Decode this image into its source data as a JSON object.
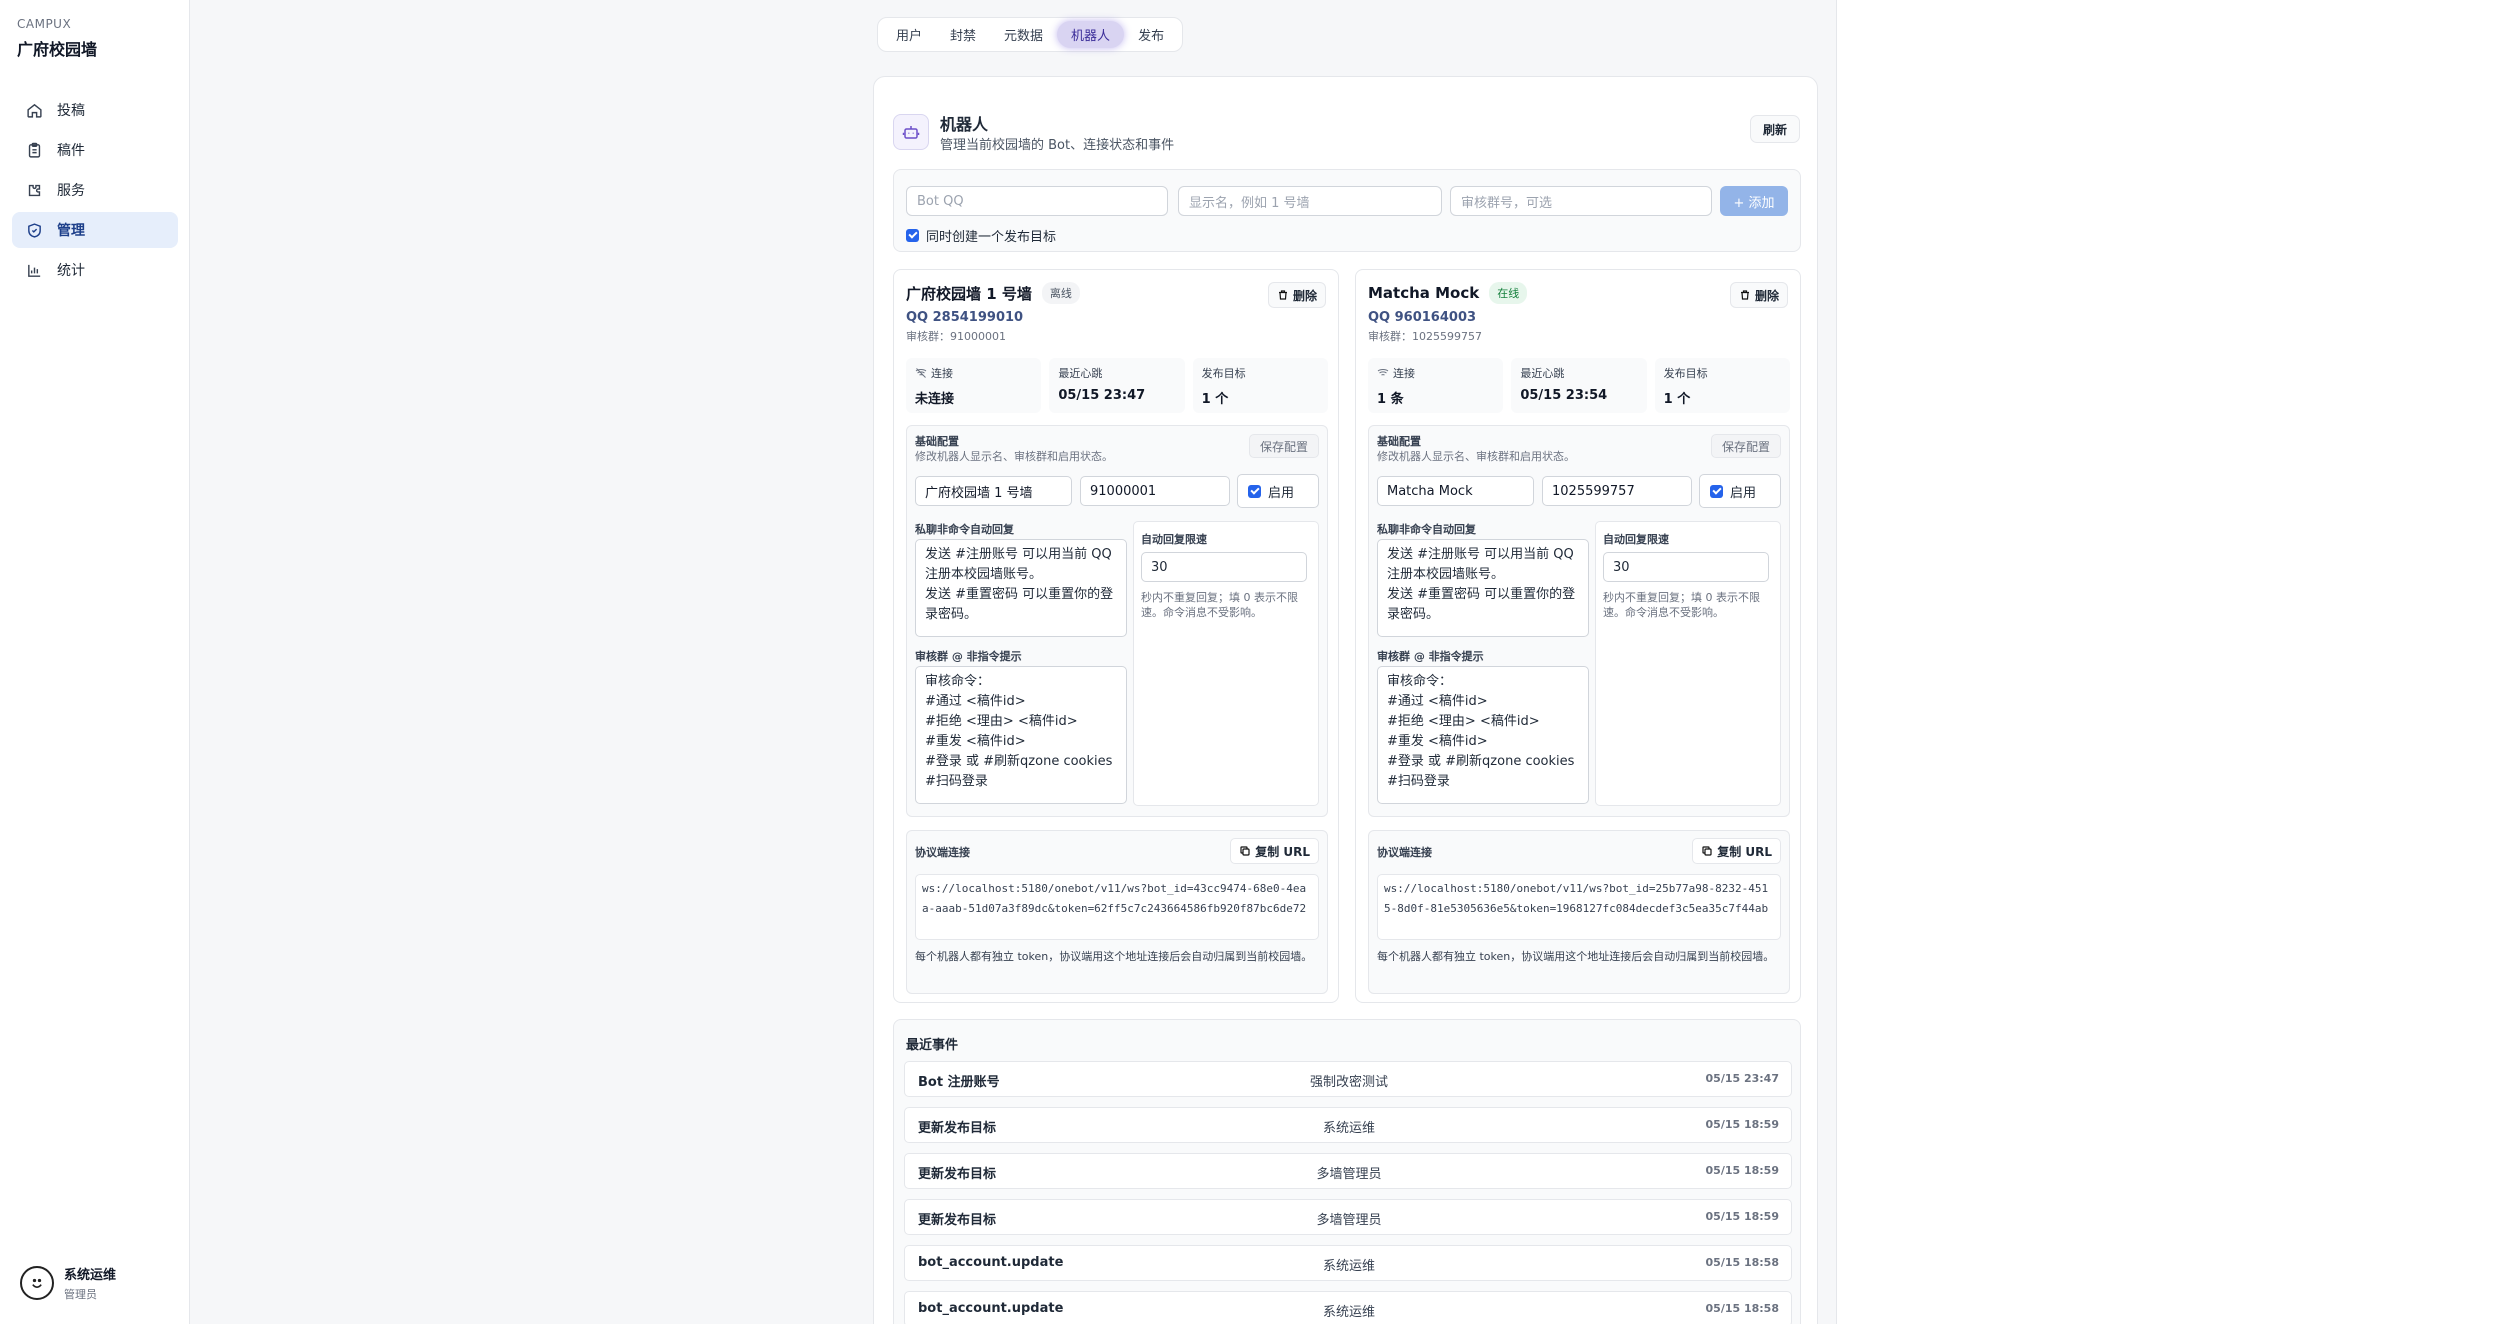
{
  "brand": {
    "small": "CAMPUX",
    "title": "广府校园墙"
  },
  "nav": [
    {
      "label": "投稿",
      "icon": "home-icon",
      "active": false
    },
    {
      "label": "稿件",
      "icon": "clipboard-icon",
      "active": false
    },
    {
      "label": "服务",
      "icon": "puzzle-icon",
      "active": false
    },
    {
      "label": "管理",
      "icon": "shield-check-icon",
      "active": true
    },
    {
      "label": "统计",
      "icon": "bar-chart-icon",
      "active": false
    }
  ],
  "user": {
    "name": "系统运维",
    "role": "管理员"
  },
  "tabs": [
    {
      "label": "用户"
    },
    {
      "label": "封禁"
    },
    {
      "label": "元数据"
    },
    {
      "label": "机器人",
      "active": true
    },
    {
      "label": "发布"
    }
  ],
  "header": {
    "title": "机器人",
    "subtitle": "管理当前校园墙的 Bot、连接状态和事件",
    "refresh_label": "刷新"
  },
  "add_form": {
    "qq_placeholder": "Bot QQ",
    "name_placeholder": "显示名，例如 1 号墙",
    "group_placeholder": "审核群号，可选",
    "add_label": "+ 添加",
    "checkbox_label": "同时创建一个发布目标",
    "checkbox_checked": true
  },
  "bots": [
    {
      "name": "广府校园墙 1 号墙",
      "status": "离线",
      "delete_label": "删除",
      "qq": "QQ 2854199010",
      "review_group": "审核群：91000001",
      "stats": [
        {
          "label": "连接",
          "value": "未连接"
        },
        {
          "label": "最近心跳",
          "value": "05/15 23:47"
        },
        {
          "label": "发布目标",
          "value": "1 个"
        }
      ],
      "config": {
        "title": "基础配置",
        "subtitle": "修改机器人显示名、审核群和启用状态。",
        "save_label": "保存配置",
        "name_value": "广府校园墙 1 号墙",
        "group_value": "91000001",
        "enable_label": "启用",
        "private_label": "私聊非命令自动回复",
        "private_text": "发送 #注册账号 可以用当前 QQ 注册本校园墙账号。\n发送 #重置密码 可以重置你的登录密码。",
        "group_label": "审核群 @ 非指令提示",
        "group_text": "审核命令：\n#通过 <稿件id>\n#拒绝 <理由> <稿件id>\n#重发 <稿件id>\n#登录 或 #刷新qzone cookies\n#扫码登录",
        "rate_label": "自动回复限速",
        "rate_value": "30",
        "rate_hint": "秒内不重复回复；填 0 表示不限速。命令消息不受影响。"
      },
      "protocol": {
        "label": "协议端连接",
        "copy_label": "复制 URL",
        "url": "ws://localhost:5180/onebot/v11/ws?bot_id=43cc9474-68e0-4eaa-aaab-51d07a3f89dc&token=62ff5c7c243664586fb920f87bc6de72",
        "hint": "每个机器人都有独立 token，协议端用这个地址连接后会自动归属到当前校园墙。"
      }
    },
    {
      "name": "Matcha Mock",
      "status": "在线",
      "delete_label": "删除",
      "qq": "QQ 960164003",
      "review_group": "审核群：1025599757",
      "stats": [
        {
          "label": "连接",
          "value": "1 条"
        },
        {
          "label": "最近心跳",
          "value": "05/15 23:54"
        },
        {
          "label": "发布目标",
          "value": "1 个"
        }
      ],
      "config": {
        "title": "基础配置",
        "subtitle": "修改机器人显示名、审核群和启用状态。",
        "save_label": "保存配置",
        "name_value": "Matcha Mock",
        "group_value": "1025599757",
        "enable_label": "启用",
        "private_label": "私聊非命令自动回复",
        "private_text": "发送 #注册账号 可以用当前 QQ 注册本校园墙账号。\n发送 #重置密码 可以重置你的登录密码。",
        "group_label": "审核群 @ 非指令提示",
        "group_text": "审核命令：\n#通过 <稿件id>\n#拒绝 <理由> <稿件id>\n#重发 <稿件id>\n#登录 或 #刷新qzone cookies\n#扫码登录",
        "rate_label": "自动回复限速",
        "rate_value": "30",
        "rate_hint": "秒内不重复回复；填 0 表示不限速。命令消息不受影响。"
      },
      "protocol": {
        "label": "协议端连接",
        "copy_label": "复制 URL",
        "url": "ws://localhost:5180/onebot/v11/ws?bot_id=25b77a98-8232-4515-8d0f-81e5305636e5&token=1968127fc084decdef3c5ea35c7f44ab",
        "hint": "每个机器人都有独立 token，协议端用这个地址连接后会自动归属到当前校园墙。"
      }
    }
  ],
  "events": {
    "title": "最近事件",
    "rows": [
      {
        "name": "Bot 注册账号",
        "actor": "强制改密测试",
        "time": "05/15 23:47"
      },
      {
        "name": "更新发布目标",
        "actor": "系统运维",
        "time": "05/15 18:59"
      },
      {
        "name": "更新发布目标",
        "actor": "多墙管理员",
        "time": "05/15 18:59"
      },
      {
        "name": "更新发布目标",
        "actor": "多墙管理员",
        "time": "05/15 18:59"
      },
      {
        "name": "bot_account.update",
        "actor": "系统运维",
        "time": "05/15 18:58"
      },
      {
        "name": "bot_account.update",
        "actor": "系统运维",
        "time": "05/15 18:58"
      }
    ]
  },
  "colors": {
    "accent": "#2563eb",
    "nav_active_bg": "#e6eefb",
    "online": "#15803d",
    "tab_active": "#d9d4f2"
  }
}
